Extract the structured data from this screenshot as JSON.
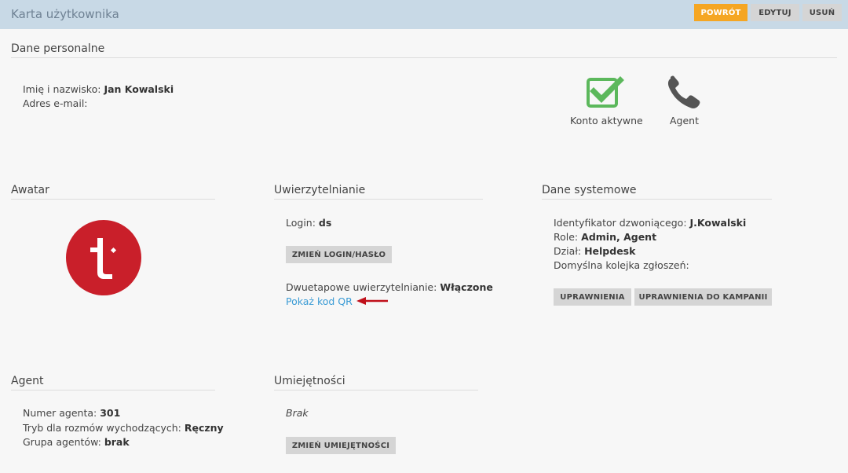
{
  "header": {
    "title": "Karta użytkownika",
    "buttons": {
      "back": "POWRÓT",
      "edit": "EDYTUJ",
      "delete": "USUŃ"
    }
  },
  "personal": {
    "section_title": "Dane personalne",
    "name_label": "Imię i nazwisko:",
    "name_value": "Jan Kowalski",
    "email_label": "Adres e-mail:",
    "email_value": "",
    "status_active": "Konto aktywne",
    "status_agent": "Agent"
  },
  "avatar": {
    "section_title": "Awatar",
    "logo_letter": "t"
  },
  "auth": {
    "section_title": "Uwierzytelnianie",
    "login_label": "Login:",
    "login_value": "ds",
    "change_button": "ZMIEŃ LOGIN/HASŁO",
    "twofa_label": "Dwuetapowe uwierzytelnianie:",
    "twofa_value": "Włączone",
    "qr_link": "Pokaż kod QR"
  },
  "system": {
    "section_title": "Dane systemowe",
    "caller_id_label": "Identyfikator dzwoniącego:",
    "caller_id_value": "J.Kowalski",
    "roles_label": "Role:",
    "roles_value": "Admin, Agent",
    "dept_label": "Dział:",
    "dept_value": "Helpdesk",
    "queue_label": "Domyślna kolejka zgłoszeń:",
    "permissions_button": "UPRAWNIENIA",
    "campaign_permissions_button": "UPRAWNIENIA DO KAMPANII"
  },
  "agent": {
    "section_title": "Agent",
    "number_label": "Numer agenta:",
    "number_value": "301",
    "mode_label": "Tryb dla rozmów wychodzących:",
    "mode_value": "Ręczny",
    "group_label": "Grupa agentów:",
    "group_value": "brak"
  },
  "skills": {
    "section_title": "Umiejętności",
    "empty_text": "Brak",
    "change_button": "ZMIEŃ UMIEJĘTNOŚCI"
  },
  "colors": {
    "accent_orange": "#f5a623",
    "header_bg": "#c8d9e6",
    "link": "#3a9bd5",
    "logo_red": "#c91f2a",
    "check_green": "#5cb85c",
    "arrow_red": "#c0101a"
  }
}
